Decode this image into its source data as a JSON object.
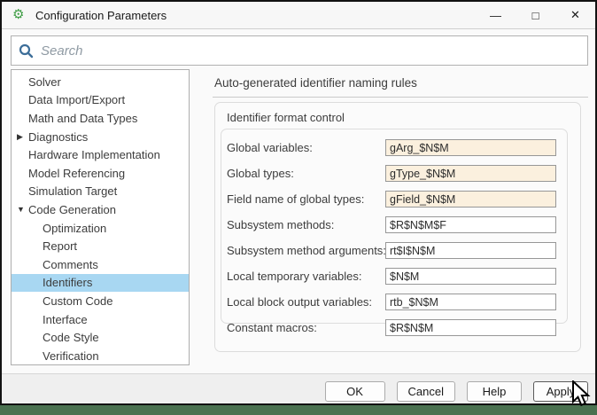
{
  "window": {
    "title": "Configuration Parameters",
    "controls": [
      {
        "name": "minimize",
        "glyph": "—"
      },
      {
        "name": "maximize",
        "glyph": "□"
      },
      {
        "name": "close",
        "glyph": "✕"
      }
    ],
    "app_icon": "⚙"
  },
  "search": {
    "placeholder": "Search"
  },
  "sidebar": {
    "items": [
      {
        "label": "Solver",
        "arrow": "",
        "level": 0,
        "selected": false
      },
      {
        "label": "Data Import/Export",
        "arrow": "",
        "level": 0,
        "selected": false
      },
      {
        "label": "Math and Data Types",
        "arrow": "",
        "level": 0,
        "selected": false
      },
      {
        "label": "Diagnostics",
        "arrow": "▶",
        "level": 0,
        "selected": false
      },
      {
        "label": "Hardware Implementation",
        "arrow": "",
        "level": 0,
        "selected": false
      },
      {
        "label": "Model Referencing",
        "arrow": "",
        "level": 0,
        "selected": false
      },
      {
        "label": "Simulation Target",
        "arrow": "",
        "level": 0,
        "selected": false
      },
      {
        "label": "Code Generation",
        "arrow": "▼",
        "level": 0,
        "selected": false
      },
      {
        "label": "Optimization",
        "arrow": "",
        "level": 1,
        "selected": false
      },
      {
        "label": "Report",
        "arrow": "",
        "level": 1,
        "selected": false
      },
      {
        "label": "Comments",
        "arrow": "",
        "level": 1,
        "selected": false
      },
      {
        "label": "Identifiers",
        "arrow": "",
        "level": 1,
        "selected": true
      },
      {
        "label": "Custom Code",
        "arrow": "",
        "level": 1,
        "selected": false
      },
      {
        "label": "Interface",
        "arrow": "",
        "level": 1,
        "selected": false
      },
      {
        "label": "Code Style",
        "arrow": "",
        "level": 1,
        "selected": false
      },
      {
        "label": "Verification",
        "arrow": "",
        "level": 1,
        "selected": false
      }
    ]
  },
  "main": {
    "heading": "Auto-generated identifier naming rules",
    "group_title": "Identifier format control",
    "fields": [
      {
        "label": "Global variables:",
        "value": "gArg_$N$M",
        "modified": true
      },
      {
        "label": "Global types:",
        "value": "gType_$N$M",
        "modified": true
      },
      {
        "label": "Field name of global types:",
        "value": "gField_$N$M",
        "modified": true
      },
      {
        "label": "Subsystem methods:",
        "value": "$R$N$M$F",
        "modified": false
      },
      {
        "label": "Subsystem method arguments:",
        "value": "rt$I$N$M",
        "modified": false
      },
      {
        "label": "Local temporary variables:",
        "value": "$N$M",
        "modified": false
      },
      {
        "label": "Local block output variables:",
        "value": "rtb_$N$M",
        "modified": false
      },
      {
        "label": "Constant macros:",
        "value": "$R$N$M",
        "modified": false
      }
    ]
  },
  "footer": {
    "buttons": [
      "OK",
      "Cancel",
      "Help",
      "Apply"
    ]
  },
  "colors": {
    "selection": "#a8d7f2",
    "modified_field": "#fbf0de",
    "desktop": "#4a7150",
    "search_icon": "#3d6e99",
    "gear_icon": "#3f9d45"
  }
}
